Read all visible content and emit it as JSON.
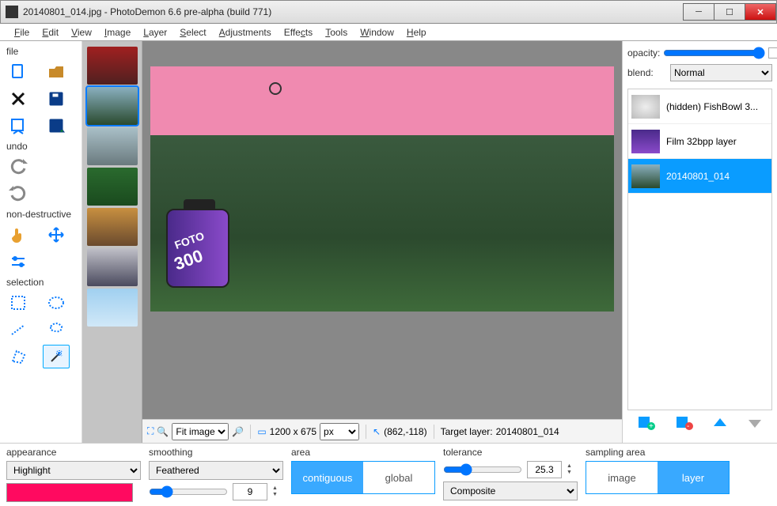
{
  "title": "20140801_014.jpg  -  PhotoDemon 6.6 pre-alpha (build 771)",
  "menu": [
    "File",
    "Edit",
    "View",
    "Image",
    "Layer",
    "Select",
    "Adjustments",
    "Effects",
    "Tools",
    "Window",
    "Help"
  ],
  "toolbox": {
    "groups": {
      "file": "file",
      "undo": "undo",
      "nondestructive": "non-destructive",
      "selection": "selection"
    }
  },
  "status": {
    "zoom_mode": "Fit image",
    "dimensions": "1200 x 675",
    "units": "px",
    "cursor": "(862,-118)",
    "target_layer_label": "Target layer:",
    "target_layer": "20140801_014"
  },
  "layerpanel": {
    "opacity_label": "opacity:",
    "opacity_value": "100",
    "blend_label": "blend:",
    "blend_value": "Normal",
    "layers": [
      {
        "name": "(hidden) FishBowl 3...",
        "sel": false
      },
      {
        "name": "Film 32bpp layer",
        "sel": false
      },
      {
        "name": "20140801_014",
        "sel": true
      }
    ]
  },
  "options": {
    "appearance": {
      "label": "appearance",
      "value": "Highlight",
      "color": "#ff0a60"
    },
    "smoothing": {
      "label": "smoothing",
      "value": "Feathered",
      "amount": "9"
    },
    "area": {
      "label": "area",
      "a": "contiguous",
      "b": "global"
    },
    "tolerance": {
      "label": "tolerance",
      "value": "25.3",
      "mode": "Composite"
    },
    "sampling": {
      "label": "sampling area",
      "a": "image",
      "b": "layer"
    }
  }
}
